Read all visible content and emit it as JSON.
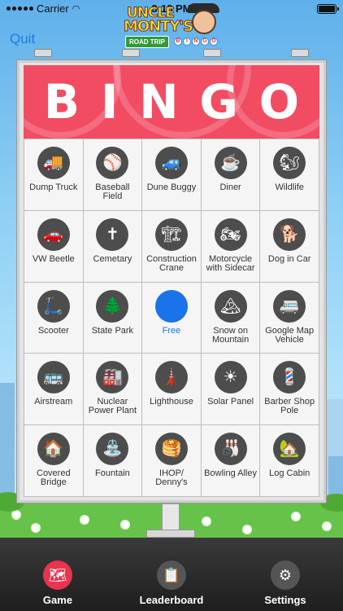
{
  "status": {
    "carrier": "Carrier",
    "time": "3:18 PM"
  },
  "header": {
    "quit_label": "Quit"
  },
  "logo": {
    "line1": "UNCLE",
    "line2": "MONTY'S",
    "badge": "ROAD TRIP",
    "mini": [
      "B",
      "I",
      "N",
      "G",
      "O"
    ]
  },
  "banner": {
    "letters": [
      "B",
      "I",
      "N",
      "G",
      "O"
    ],
    "color": "#f24c63"
  },
  "cells": [
    {
      "label": "Dump Truck",
      "icon": "dump-truck-icon",
      "glyph": "🚚"
    },
    {
      "label": "Baseball Field",
      "icon": "baseball-icon",
      "glyph": "⚾"
    },
    {
      "label": "Dune Buggy",
      "icon": "dune-buggy-icon",
      "glyph": "🚙"
    },
    {
      "label": "Diner",
      "icon": "diner-icon",
      "glyph": "☕"
    },
    {
      "label": "Wildlife",
      "icon": "squirrel-icon",
      "glyph": "🐿"
    },
    {
      "label": "VW Beetle",
      "icon": "vw-beetle-icon",
      "glyph": "🚗"
    },
    {
      "label": "Cemetary",
      "icon": "gravestone-icon",
      "glyph": "✝"
    },
    {
      "label": "Construction Crane",
      "icon": "crane-icon",
      "glyph": "🏗"
    },
    {
      "label": "Motorcycle with Sidecar",
      "icon": "motorcycle-icon",
      "glyph": "🏍"
    },
    {
      "label": "Dog in Car",
      "icon": "dog-car-icon",
      "glyph": "🐕"
    },
    {
      "label": "Scooter",
      "icon": "scooter-icon",
      "glyph": "🛴"
    },
    {
      "label": "State Park",
      "icon": "trees-icon",
      "glyph": "🌲"
    },
    {
      "label": "Free",
      "icon": "free-space-icon",
      "glyph": "",
      "free": true
    },
    {
      "label": "Snow on Mountain",
      "icon": "mountain-icon",
      "glyph": "🏔"
    },
    {
      "label": "Google Map Vehicle",
      "icon": "map-vehicle-icon",
      "glyph": "🚐"
    },
    {
      "label": "Airstream",
      "icon": "airstream-icon",
      "glyph": "🚌"
    },
    {
      "label": "Nuclear Power Plant",
      "icon": "power-plant-icon",
      "glyph": "🏭"
    },
    {
      "label": "Lighthouse",
      "icon": "lighthouse-icon",
      "glyph": "🗼"
    },
    {
      "label": "Solar Panel",
      "icon": "solar-panel-icon",
      "glyph": "☀"
    },
    {
      "label": "Barber Shop Pole",
      "icon": "barber-pole-icon",
      "glyph": "💈"
    },
    {
      "label": "Covered Bridge",
      "icon": "covered-bridge-icon",
      "glyph": "🏠"
    },
    {
      "label": "Fountain",
      "icon": "fountain-icon",
      "glyph": "⛲"
    },
    {
      "label": "IHOP/ Denny's",
      "icon": "pancakes-icon",
      "glyph": "🥞"
    },
    {
      "label": "Bowling Alley",
      "icon": "bowling-icon",
      "glyph": "🎳"
    },
    {
      "label": "Log Cabin",
      "icon": "log-cabin-icon",
      "glyph": "🏡"
    }
  ],
  "tabs": [
    {
      "label": "Game",
      "icon": "map-icon",
      "glyph": "🗺",
      "active": true
    },
    {
      "label": "Leaderboard",
      "icon": "clipboard-icon",
      "glyph": "📋",
      "active": false
    },
    {
      "label": "Settings",
      "icon": "gear-icon",
      "glyph": "⚙",
      "active": false
    }
  ]
}
